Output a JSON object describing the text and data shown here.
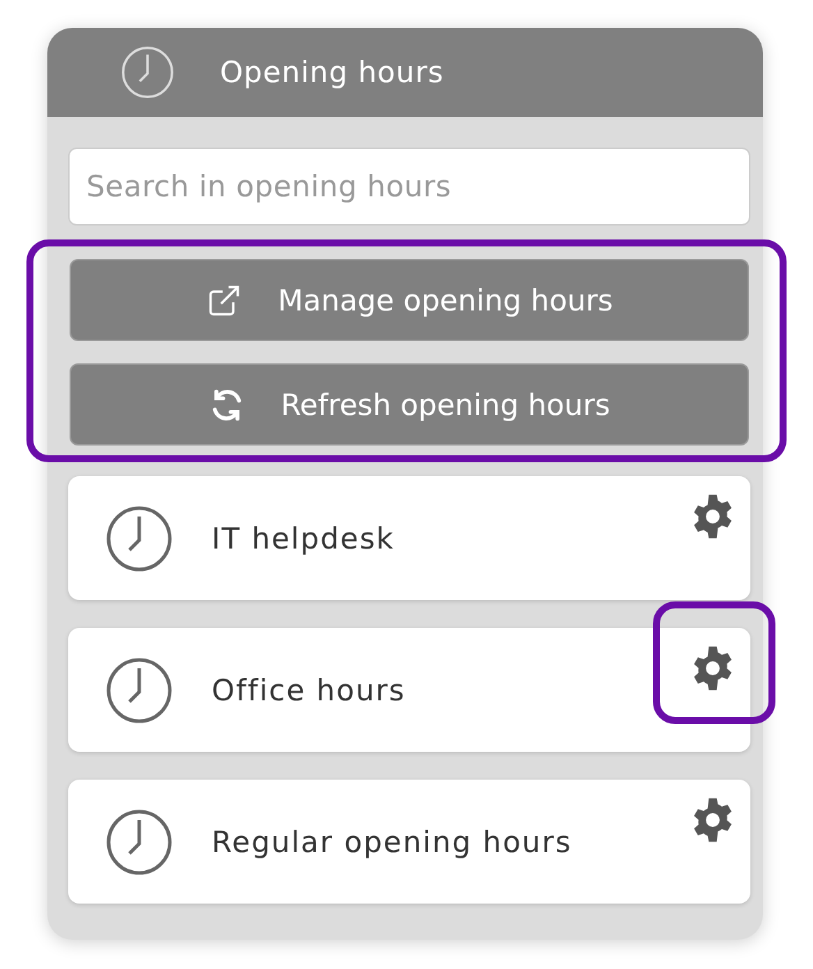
{
  "header": {
    "title": "Opening hours"
  },
  "search": {
    "placeholder": "Search in opening hours"
  },
  "actions": {
    "highlighted": true,
    "buttons": [
      {
        "kind": "manage",
        "label": "Manage opening hours"
      },
      {
        "kind": "refresh",
        "label": "Refresh opening hours"
      }
    ]
  },
  "items": [
    {
      "name": "IT helpdesk",
      "settings_highlighted": false
    },
    {
      "name": "Office hours",
      "settings_highlighted": true
    },
    {
      "name": "Regular opening hours",
      "settings_highlighted": false
    }
  ]
}
